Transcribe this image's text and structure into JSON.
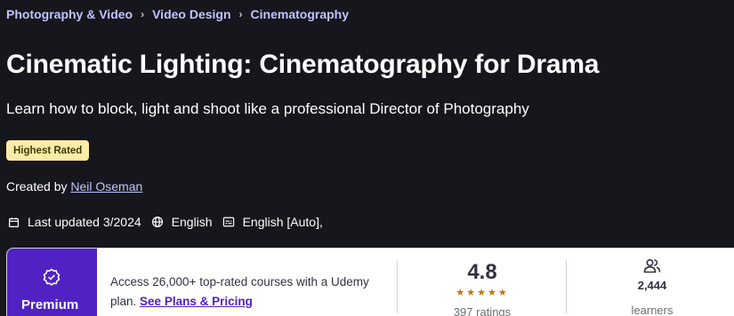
{
  "breadcrumb": {
    "items": [
      "Photography & Video",
      "Video Design",
      "Cinematography"
    ],
    "separator": "›"
  },
  "course": {
    "title": "Cinematic Lighting: Cinematography for Drama",
    "subtitle": "Learn how to block, light and shoot like a professional Director of Photography",
    "badge": "Highest Rated",
    "created_by_label": "Created by",
    "instructor": "Neil Oseman",
    "last_updated": "Last updated 3/2024",
    "language": "English",
    "captions": "English [Auto],"
  },
  "card": {
    "premium_label": "Premium",
    "access_text": "Access 26,000+ top-rated courses with a Udemy plan.",
    "plans_link": "See Plans & Pricing",
    "rating_value": "4.8",
    "stars": 5,
    "ratings_count": "397 ratings",
    "learners_count": "2,444",
    "learners_label": "learners"
  },
  "colors": {
    "background": "#16161d",
    "link": "#c0c4fc",
    "badge_bg": "#fceca7",
    "premium_bg": "#5022c3",
    "star": "#c4710d"
  },
  "icons": {
    "calendar": "calendar-icon",
    "globe": "globe-icon",
    "captions": "captions-icon",
    "premium": "badge-check-icon",
    "learners": "users-icon"
  }
}
